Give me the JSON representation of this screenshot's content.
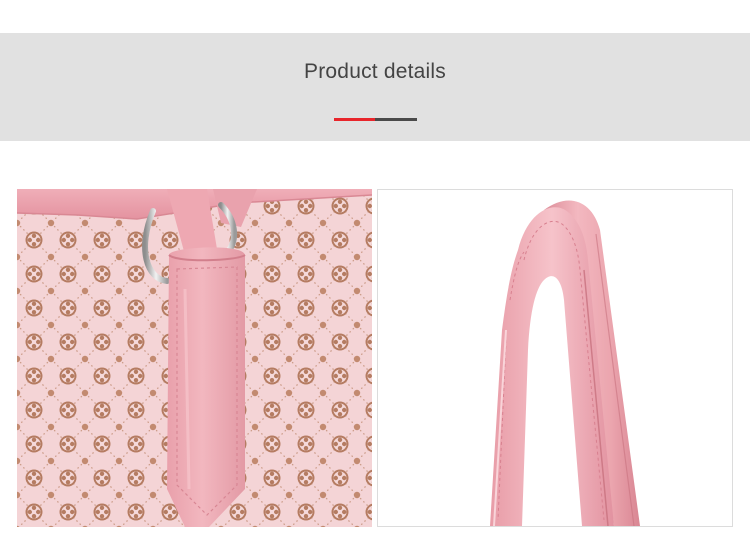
{
  "header": {
    "title": "Product details",
    "accent_color": "#e8252b",
    "rest_color": "#4a4a4a",
    "background_color": "#e1e1e1"
  },
  "images": [
    {
      "name": "fabric-closeup-photo",
      "base_color": "#f4d4d6",
      "pattern_color": "#b98066",
      "leather_color": "#eea8b2"
    },
    {
      "name": "strap-closeup-photo",
      "base_color": "#ffffff",
      "leather_color": "#efb0b8"
    }
  ]
}
